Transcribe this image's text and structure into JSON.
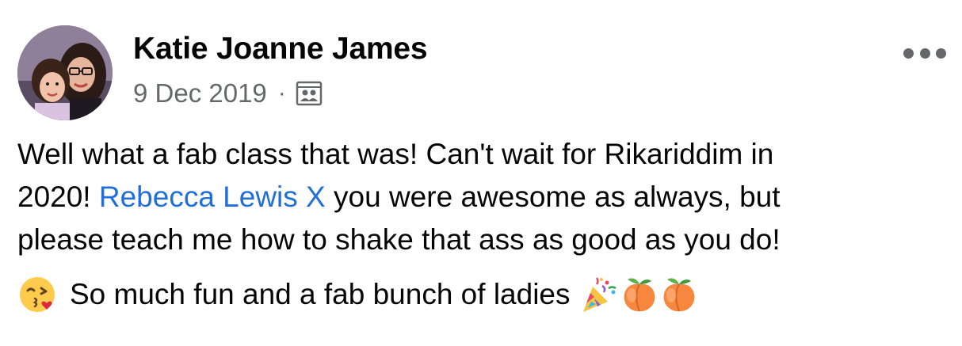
{
  "post": {
    "author": "Katie Joanne James",
    "date": "9 Dec 2019",
    "separator": "·",
    "audience_icon": "photo-album-icon",
    "more_icon": "more-options-icon",
    "text_part1": "Well what a fab class that was! Can't wait for Rikariddim in",
    "text_part2": "2020! ",
    "mention": "Rebecca Lewis X",
    "text_part3": " you were awesome  as always, but",
    "text_part4": "please teach me how to shake that ass as good as you do!",
    "line2_text": "So much fun and a fab bunch of ladies",
    "emojis": [
      "face-blowing-kiss-emoji",
      "party-popper-emoji",
      "peach-emoji",
      "peach-emoji"
    ]
  },
  "colors": {
    "text": "#050505",
    "meta": "#65676b",
    "mention": "#216fdb"
  }
}
